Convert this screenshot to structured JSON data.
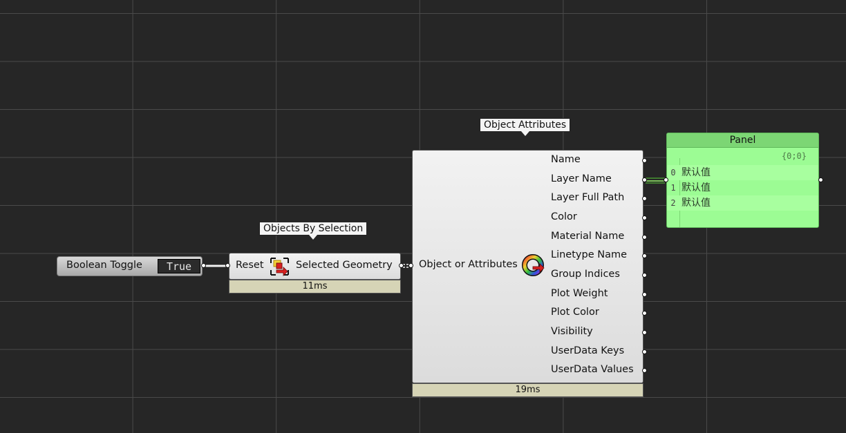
{
  "canvas": {
    "background": "#262626",
    "grid_color": "#4a4a4a"
  },
  "boolean_toggle": {
    "label": "Boolean Toggle",
    "value": "True"
  },
  "objects_by_selection": {
    "tooltip": "Objects By Selection",
    "input": "Reset",
    "output": "Selected Geometry",
    "icon": "geometry-selection-icon",
    "timing": "11ms"
  },
  "object_attributes": {
    "tooltip": "Object Attributes",
    "input": "Object or Attributes",
    "icon": "attributes-ring-icon",
    "outputs": [
      "Name",
      "Layer Name",
      "Layer Full Path",
      "Color",
      "Material Name",
      "Linetype Name",
      "Group Indices",
      "Plot Weight",
      "Plot Color",
      "Visibility",
      "UserData Keys",
      "UserData Values"
    ],
    "timing": "19ms"
  },
  "panel": {
    "title": "Panel",
    "path": "{0;0}",
    "rows": [
      {
        "index": "0",
        "value": "默认值"
      },
      {
        "index": "1",
        "value": "默认值"
      },
      {
        "index": "2",
        "value": "默认值"
      }
    ],
    "color": "#9cfc94"
  }
}
